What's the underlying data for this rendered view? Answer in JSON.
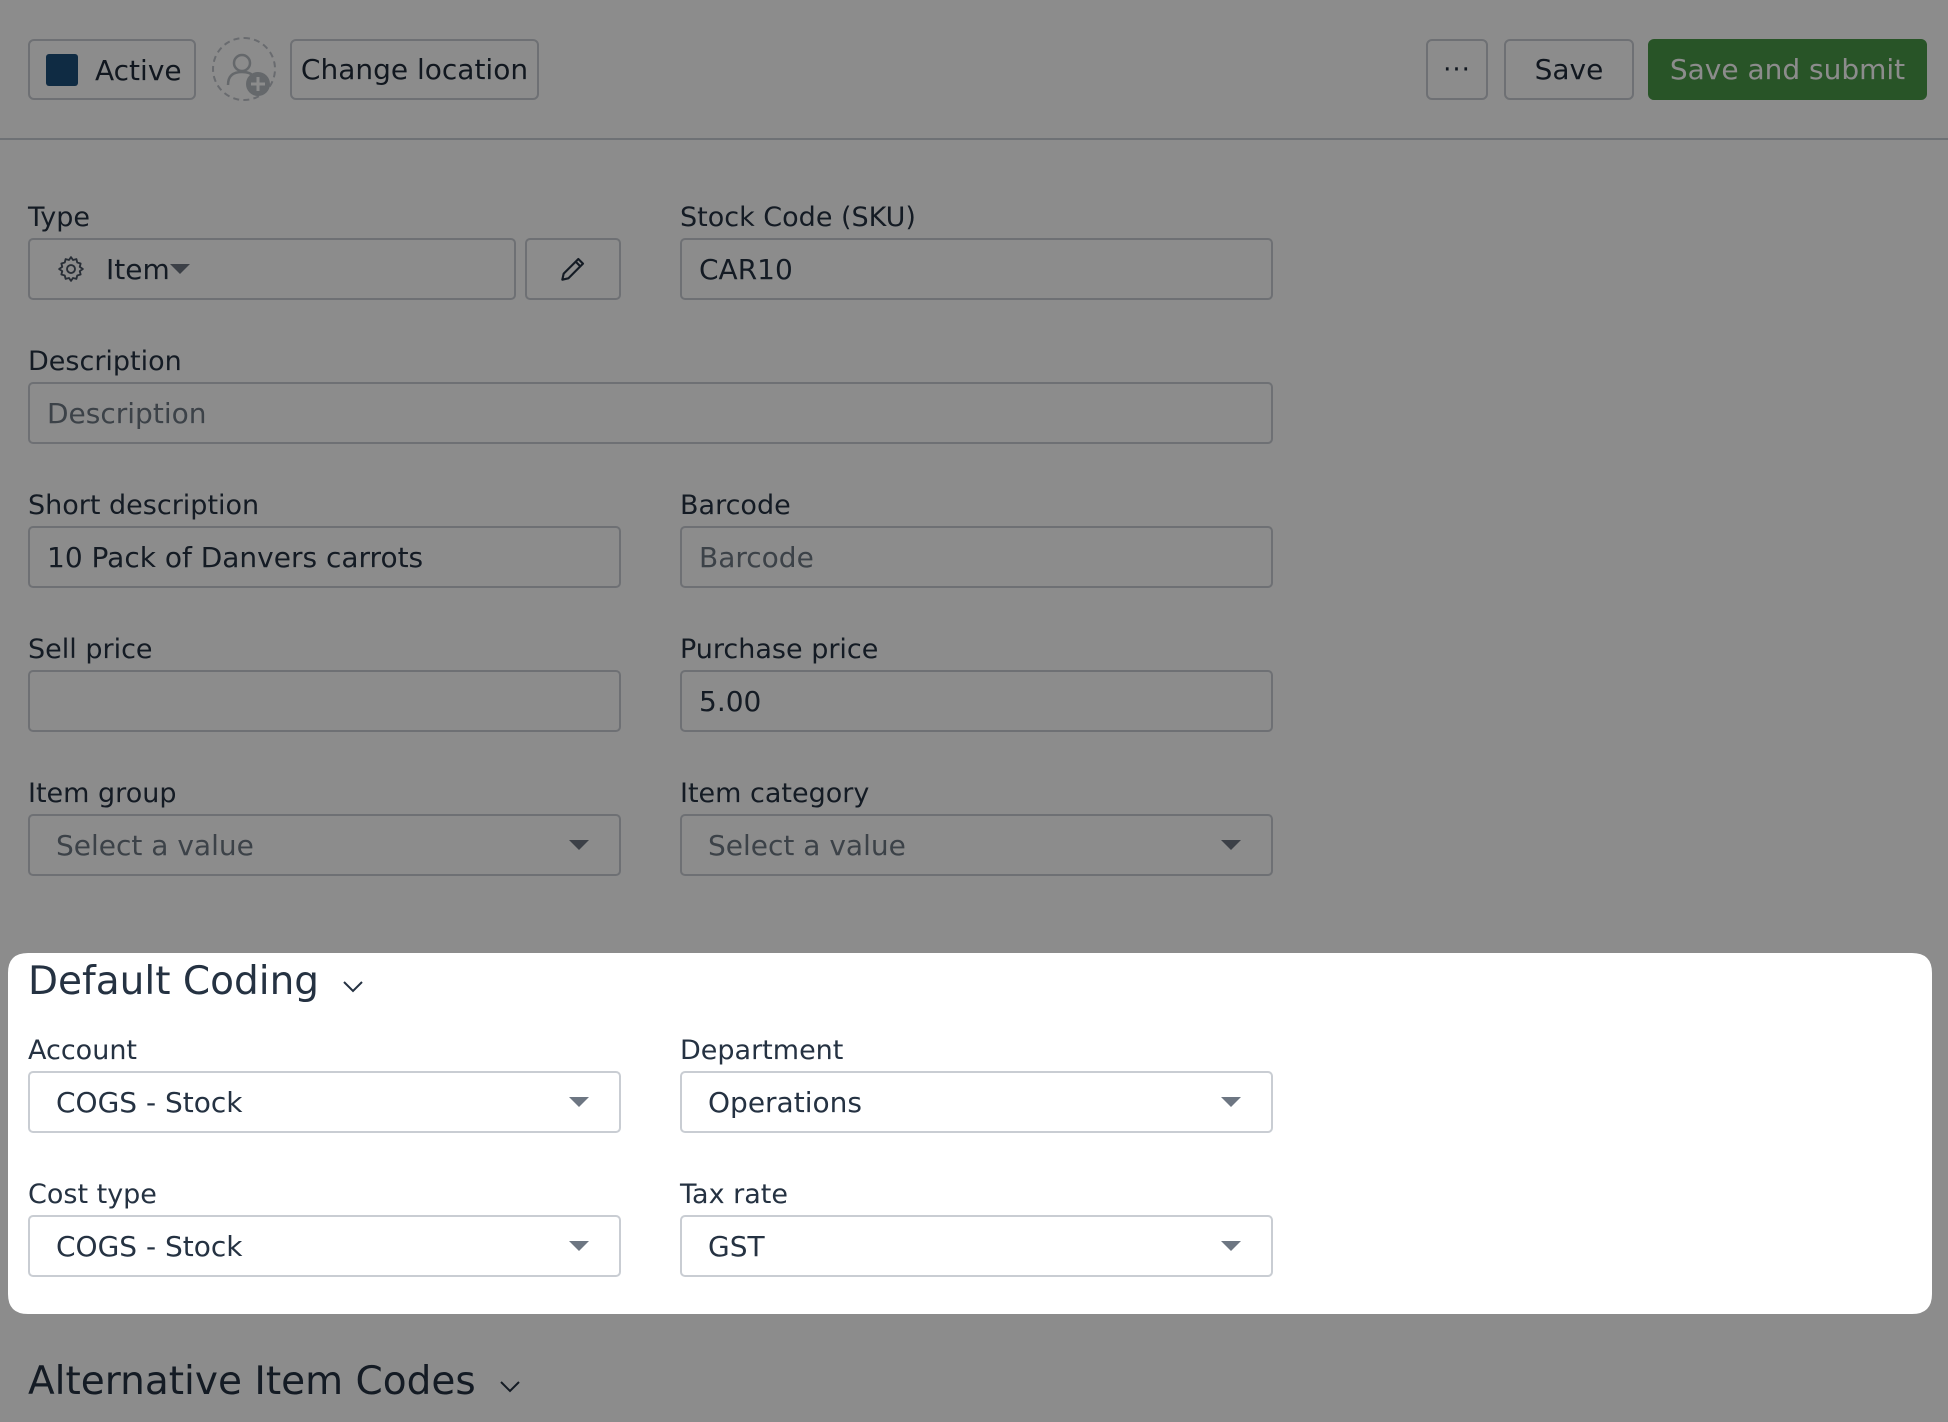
{
  "toolbar": {
    "status_label": "Active",
    "status_color": "#1d4f7a",
    "change_location_label": "Change location",
    "more_label": "···",
    "save_label": "Save",
    "save_submit_label": "Save and submit",
    "save_submit_color": "#4a9a48"
  },
  "form": {
    "type": {
      "label": "Type",
      "value": "Item",
      "icon": "gear-icon",
      "edit_icon": "pencil-icon"
    },
    "stock_code": {
      "label": "Stock Code (SKU)",
      "value": "CAR10"
    },
    "description": {
      "label": "Description",
      "value": "",
      "placeholder": "Description"
    },
    "short_description": {
      "label": "Short description",
      "value": "10 Pack of Danvers carrots"
    },
    "barcode": {
      "label": "Barcode",
      "value": "",
      "placeholder": "Barcode"
    },
    "sell_price": {
      "label": "Sell price",
      "value": ""
    },
    "purchase_price": {
      "label": "Purchase price",
      "value": "5.00"
    },
    "item_group": {
      "label": "Item group",
      "value": "Select a value"
    },
    "item_category": {
      "label": "Item category",
      "value": "Select a value"
    }
  },
  "default_coding": {
    "title": "Default Coding",
    "account": {
      "label": "Account",
      "value": "COGS - Stock"
    },
    "department": {
      "label": "Department",
      "value": "Operations"
    },
    "cost_type": {
      "label": "Cost type",
      "value": "COGS - Stock"
    },
    "tax_rate": {
      "label": "Tax rate",
      "value": "GST"
    }
  },
  "alternative_codes": {
    "title": "Alternative Item Codes"
  },
  "highlight": {
    "target": "default-coding-section",
    "overlay_color": "#000000"
  }
}
